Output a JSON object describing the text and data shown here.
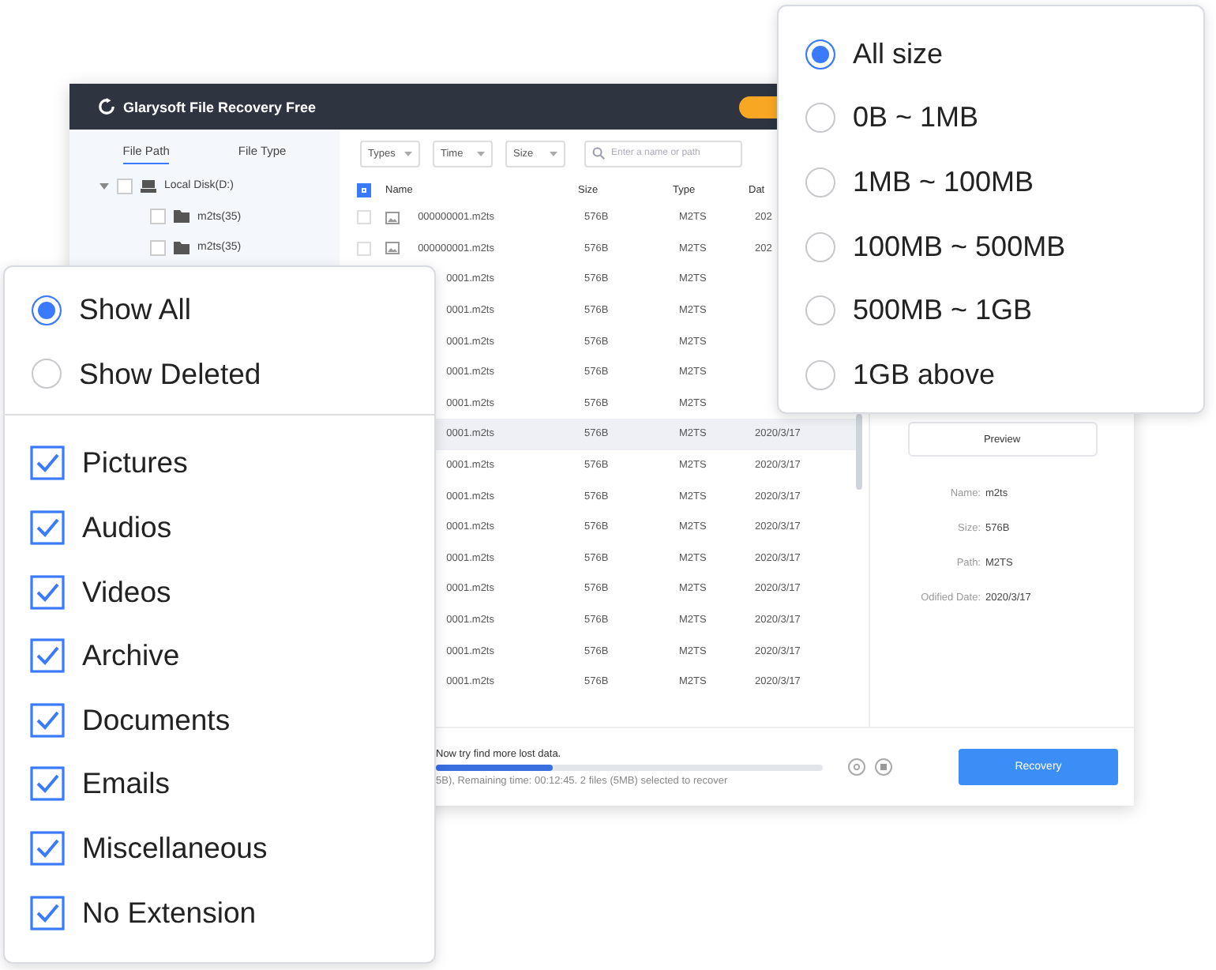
{
  "app": {
    "title": "Glarysoft File Recovery Free",
    "sidebar": {
      "tabs": [
        {
          "label": "File Path",
          "selected": true
        },
        {
          "label": "File Type",
          "selected": false
        }
      ],
      "tree": [
        {
          "label": "Local Disk(D:)",
          "expanded": true,
          "checked": false,
          "children": [
            {
              "label": "m2ts(35)",
              "checked": false
            },
            {
              "label": "m2ts(35)",
              "checked": false
            }
          ]
        }
      ]
    },
    "filters": [
      {
        "label": "Types"
      },
      {
        "label": "Time"
      },
      {
        "label": "Size"
      }
    ],
    "search": {
      "placeholder": "Enter a name or path"
    },
    "table": {
      "columns": [
        "Name",
        "Size",
        "Type",
        "Dat"
      ],
      "all_checked": true,
      "rows": [
        {
          "kind": "full",
          "checked": false,
          "name": "000000001.m2ts",
          "size": "576B",
          "type": "M2TS",
          "date": "202",
          "selected": false
        },
        {
          "kind": "full",
          "checked": false,
          "name": "000000001.m2ts",
          "size": "576B",
          "type": "M2TS",
          "date": "202",
          "selected": false
        },
        {
          "kind": "clipped",
          "name": "0001.m2ts",
          "size": "576B",
          "type": "M2TS",
          "date": "",
          "selected": false
        },
        {
          "kind": "clipped",
          "name": "0001.m2ts",
          "size": "576B",
          "type": "M2TS",
          "date": "",
          "selected": false
        },
        {
          "kind": "clipped",
          "name": "0001.m2ts",
          "size": "576B",
          "type": "M2TS",
          "date": "",
          "selected": false
        },
        {
          "kind": "clipped",
          "name": "0001.m2ts",
          "size": "576B",
          "type": "M2TS",
          "date": "",
          "selected": false
        },
        {
          "kind": "clipped",
          "name": "0001.m2ts",
          "size": "576B",
          "type": "M2TS",
          "date": "",
          "selected": false
        },
        {
          "kind": "clipped",
          "name": "0001.m2ts",
          "size": "576B",
          "type": "M2TS",
          "date": "2020/3/17",
          "selected": true
        },
        {
          "kind": "clipped",
          "name": "0001.m2ts",
          "size": "576B",
          "type": "M2TS",
          "date": "2020/3/17",
          "selected": false
        },
        {
          "kind": "clipped",
          "name": "0001.m2ts",
          "size": "576B",
          "type": "M2TS",
          "date": "2020/3/17",
          "selected": false
        },
        {
          "kind": "clipped",
          "name": "0001.m2ts",
          "size": "576B",
          "type": "M2TS",
          "date": "2020/3/17",
          "selected": false
        },
        {
          "kind": "clipped",
          "name": "0001.m2ts",
          "size": "576B",
          "type": "M2TS",
          "date": "2020/3/17",
          "selected": false
        },
        {
          "kind": "clipped",
          "name": "0001.m2ts",
          "size": "576B",
          "type": "M2TS",
          "date": "2020/3/17",
          "selected": false
        },
        {
          "kind": "clipped",
          "name": "0001.m2ts",
          "size": "576B",
          "type": "M2TS",
          "date": "2020/3/17",
          "selected": false
        },
        {
          "kind": "clipped",
          "name": "0001.m2ts",
          "size": "576B",
          "type": "M2TS",
          "date": "2020/3/17",
          "selected": false
        },
        {
          "kind": "clipped",
          "name": "0001.m2ts",
          "size": "576B",
          "type": "M2TS",
          "date": "2020/3/17",
          "selected": false
        }
      ]
    },
    "details": {
      "preview_button": "Preview",
      "fields": [
        {
          "label": "Name:",
          "value": "m2ts"
        },
        {
          "label": "Size:",
          "value": "576B"
        },
        {
          "label": "Path:",
          "value": "M2TS"
        },
        {
          "label": "Odified Date:",
          "value": "2020/3/17"
        }
      ]
    },
    "status": {
      "message": "Now try find more lost data.",
      "level": 0.3,
      "info": "5B), Remaining time: 00:12:45. 2 files (5MB) selected to recover"
    },
    "recovery_button": "Recovery"
  },
  "size_menu": {
    "options": [
      {
        "label": "All size",
        "selected": true
      },
      {
        "label": "0B ~ 1MB",
        "selected": false
      },
      {
        "label": "1MB ~ 100MB",
        "selected": false
      },
      {
        "label": "100MB ~ 500MB",
        "selected": false
      },
      {
        "label": "500MB ~ 1GB",
        "selected": false
      },
      {
        "label": "1GB above",
        "selected": false
      }
    ]
  },
  "filter_menu": {
    "show": [
      {
        "label": "Show All",
        "selected": true
      },
      {
        "label": "Show Deleted",
        "selected": false
      }
    ],
    "types": [
      {
        "label": "Pictures",
        "checked": true
      },
      {
        "label": "Audios",
        "checked": true
      },
      {
        "label": "Videos",
        "checked": true
      },
      {
        "label": "Archive",
        "checked": true
      },
      {
        "label": "Documents",
        "checked": true
      },
      {
        "label": "Emails",
        "checked": true
      },
      {
        "label": "Miscellaneous",
        "checked": true
      },
      {
        "label": "No Extension",
        "checked": true
      }
    ]
  }
}
